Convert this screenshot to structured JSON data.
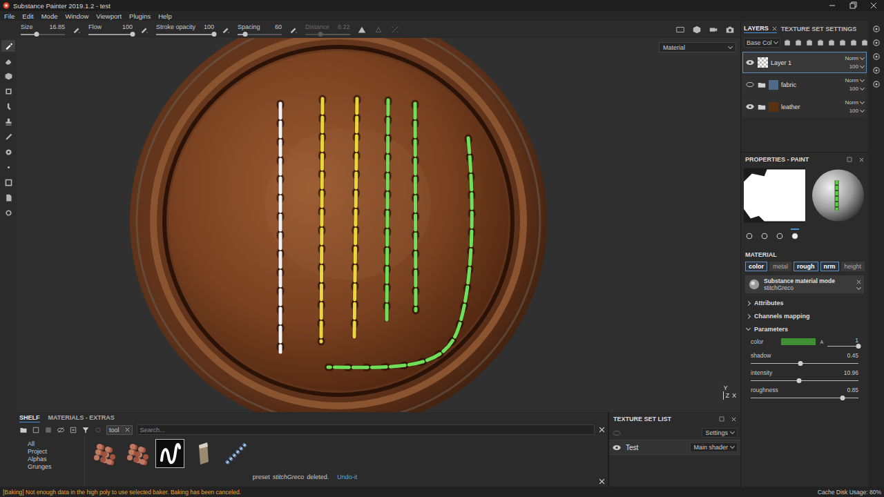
{
  "window": {
    "title": "Substance Painter 2019.1.2 - test"
  },
  "menu": [
    "File",
    "Edit",
    "Mode",
    "Window",
    "Viewport",
    "Plugins",
    "Help"
  ],
  "toolOptions": {
    "sliders": [
      {
        "label": "Size",
        "value": "16.85",
        "level": 0.36,
        "disabled": false
      },
      {
        "label": "Flow",
        "value": "100",
        "level": 1,
        "disabled": false
      },
      {
        "label": "Stroke opacity",
        "value": "100",
        "level": 1,
        "disabled": false
      },
      {
        "label": "Spacing",
        "value": "60",
        "level": 0.17,
        "disabled": false
      },
      {
        "label": "Distance",
        "value": "6.22",
        "level": 0.34,
        "disabled": true
      }
    ]
  },
  "toolbar": {
    "tools": [
      {
        "selected": true
      },
      {
        "selected": false
      },
      {
        "selected": false
      },
      {
        "selected": false
      },
      {
        "selected": false
      },
      {
        "selected": false
      },
      {
        "selected": false
      },
      {
        "selected": false
      },
      {
        "selected": false
      },
      {
        "selected": false
      },
      {
        "selected": false
      },
      {
        "selected": false
      }
    ]
  },
  "viewport": {
    "mode": "Material",
    "axes": [
      "Y",
      "Z",
      "X"
    ]
  },
  "layersPanel": {
    "tabs": [
      {
        "label": "LAYERS",
        "selected": true
      },
      {
        "label": "TEXTURE SET SETTINGS",
        "selected": false
      }
    ],
    "channel": "Base Col",
    "layers": [
      {
        "name": "Layer 1",
        "kind": "paint",
        "visible": true,
        "selected": true,
        "blend": "Norm",
        "opacity": "100",
        "color": "#9a9a9a"
      },
      {
        "name": "fabric",
        "kind": "folder",
        "visible": false,
        "selected": false,
        "blend": "Norm",
        "opacity": "100",
        "color": "#4f6a86"
      },
      {
        "name": "leather",
        "kind": "folder",
        "visible": true,
        "selected": false,
        "blend": "Norm",
        "opacity": "100",
        "color": "#5a2f12"
      }
    ]
  },
  "properties": {
    "title": "PROPERTIES - PAINT",
    "tabs": [
      {
        "selected": false
      },
      {
        "selected": false
      },
      {
        "selected": false
      },
      {
        "selected": true
      }
    ],
    "section": "MATERIAL",
    "channels": [
      {
        "label": "color",
        "selected": true
      },
      {
        "label": "metal",
        "selected": false
      },
      {
        "label": "rough",
        "selected": true
      },
      {
        "label": "nrm",
        "selected": true
      },
      {
        "label": "height",
        "selected": false
      }
    ],
    "material": {
      "mode": "Substance material mode",
      "name": "stitchGreco"
    },
    "groups": [
      {
        "label": "Attributes",
        "expanded": false
      },
      {
        "label": "Channels mapping",
        "expanded": false
      },
      {
        "label": "Parameters",
        "expanded": true
      }
    ],
    "color": {
      "label": "color",
      "value": "#3f8f33",
      "alphaLabel": "A",
      "alpha": "1",
      "level": 1
    },
    "params": [
      {
        "label": "shadow",
        "value": "0.45",
        "level": 0.46
      },
      {
        "label": "intensity",
        "value": "10.96",
        "level": 0.45
      },
      {
        "label": "roughness",
        "value": "0.85",
        "level": 0.85
      }
    ]
  },
  "shelf": {
    "tabs": [
      {
        "label": "SHELF",
        "selected": true
      },
      {
        "label": "MATERIALS - EXTRAS",
        "selected": false
      }
    ],
    "filter": "tool",
    "placeholder": "Search...",
    "categories": [
      "All",
      "Project",
      "Alphas",
      "Grunges"
    ],
    "items": [
      {
        "selected": false
      },
      {
        "selected": false
      },
      {
        "selected": true
      },
      {
        "selected": false
      },
      {
        "selected": false
      }
    ],
    "message": {
      "prefix": "preset",
      "name": "stitchGreco",
      "suffix": "deleted.",
      "link": "Undo-it"
    }
  },
  "textureSets": {
    "title": "TEXTURE SET LIST",
    "settings": "Settings",
    "sets": [
      {
        "name": "Test",
        "shader": "Main shader",
        "visible": true
      }
    ]
  },
  "status": {
    "message": "[Baking] Not enough data in the high poly to use selected baker. Baking has been canceled.",
    "cache": "Cache Disk Usage: 80%"
  }
}
